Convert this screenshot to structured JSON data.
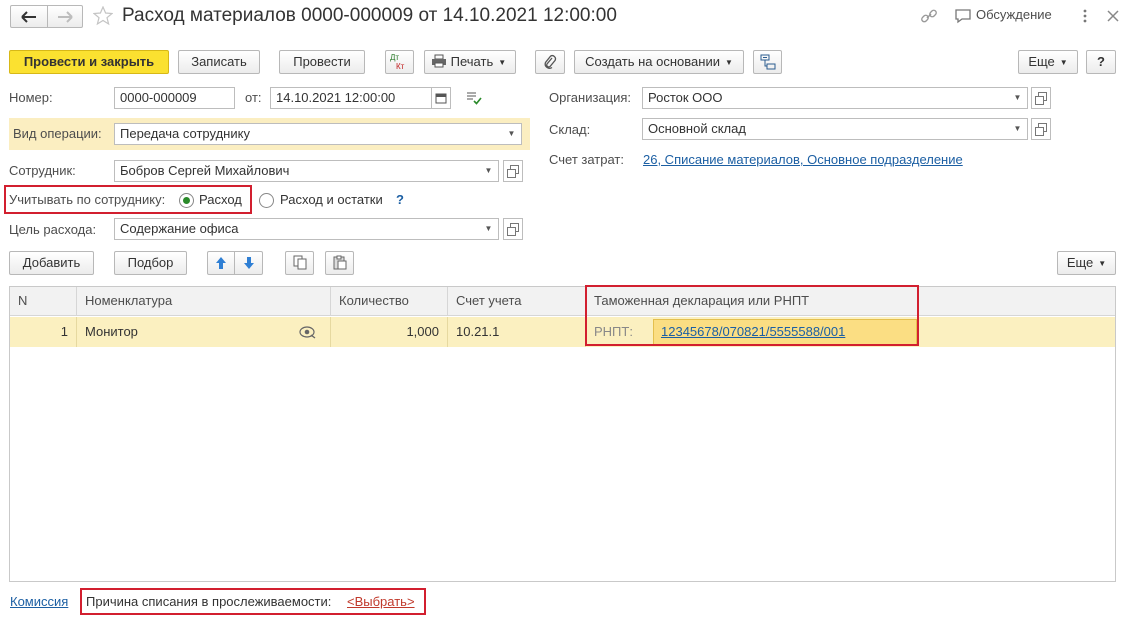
{
  "window": {
    "title": "Расход материалов 0000-000009 от 14.10.2021 12:00:00",
    "discussion_label": "Обсуждение"
  },
  "toolbar": {
    "post_close_label": "Провести и закрыть",
    "save_label": "Записать",
    "post_label": "Провести",
    "dtkt_label_top": "Дт",
    "dtkt_label_bottom": "Кт",
    "print_label": "Печать",
    "create_based_label": "Создать на основании",
    "more_label": "Еще",
    "help_label": "?"
  },
  "form": {
    "number_label": "Номер:",
    "number_value": "0000-000009",
    "date_label": "от:",
    "date_value": "14.10.2021 12:00:00",
    "operation_label": "Вид операции:",
    "operation_value": "Передача сотруднику",
    "employee_label": "Сотрудник:",
    "employee_value": "Бобров Сергей Михайлович",
    "track_label": "Учитывать по сотруднику:",
    "track_options": [
      "Расход",
      "Расход и остатки"
    ],
    "track_selected": "Расход",
    "track_help": "?",
    "purpose_label": "Цель расхода:",
    "purpose_value": "Содержание офиса",
    "org_label": "Организация:",
    "org_value": "Росток ООО",
    "warehouse_label": "Склад:",
    "warehouse_value": "Основной склад",
    "cost_account_label": "Счет затрат:",
    "cost_account_value": "26, Списание материалов, Основное подразделение"
  },
  "table_toolbar": {
    "add_label": "Добавить",
    "pick_label": "Подбор",
    "more_label": "Еще"
  },
  "table": {
    "columns": [
      "N",
      "Номенклатура",
      "Количество",
      "Счет учета",
      "Таможенная декларация или РНПТ"
    ],
    "rows": [
      {
        "n": "1",
        "item": "Монитор",
        "quantity": "1,000",
        "account": "10.21.1",
        "rnpt_prefix": "РНПТ:",
        "rnpt_value": "12345678/070821/5555588/001"
      }
    ]
  },
  "footer": {
    "commission_link": "Комиссия",
    "reason_label": "Причина списания в прослеживаемости:",
    "reason_link": "<Выбрать>"
  },
  "colors": {
    "primary_button": "#fbe130",
    "selected_row": "#fbf0c0",
    "link": "#1c5fa3",
    "highlight_box": "#d21f2f",
    "operation_highlight": "#fbeec1"
  }
}
